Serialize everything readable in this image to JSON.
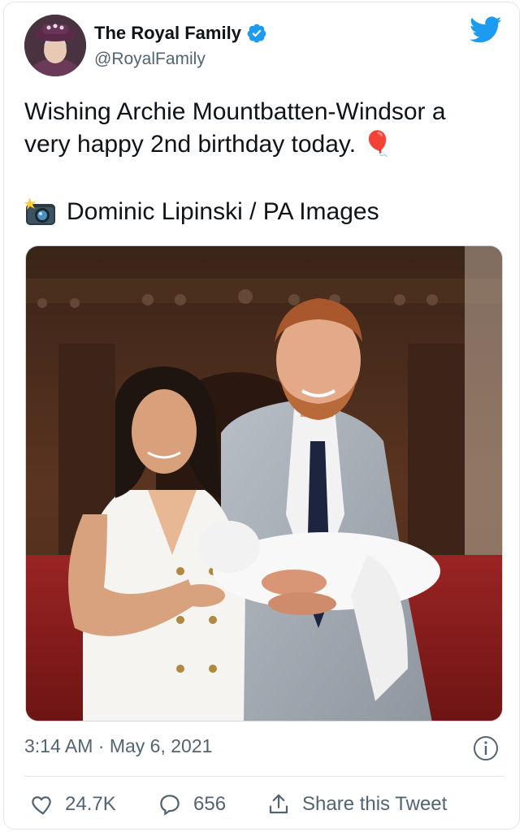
{
  "author": {
    "name": "The Royal Family",
    "handle": "@RoyalFamily",
    "verified": true
  },
  "tweet": {
    "text": "Wishing Archie Mountbatten-Windsor a\nvery happy 2nd birthday today. 🎈",
    "credit": "Dominic Lipinski / PA Images",
    "credit_icon": "camera-flash-icon"
  },
  "meta": {
    "timestamp": "3:14 AM · May 6, 2021"
  },
  "actions": {
    "likes": "24.7K",
    "replies": "656",
    "share_label": "Share this Tweet"
  },
  "colors": {
    "twitter_blue": "#1d9bf0",
    "secondary_text": "#536471",
    "primary_text": "#0f1419"
  }
}
